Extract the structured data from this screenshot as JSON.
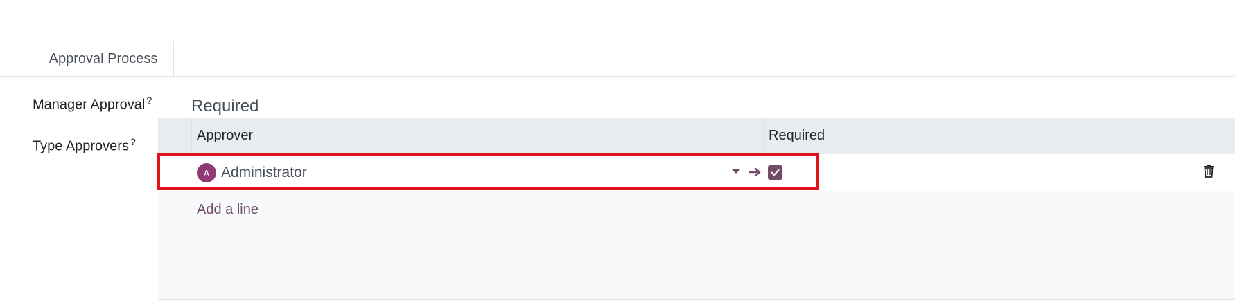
{
  "tabs": [
    {
      "label": "Approval Process"
    }
  ],
  "fields": {
    "manager_approval": {
      "label": "Manager Approval",
      "help": "?",
      "value": "Required"
    },
    "type_approvers": {
      "label": "Type Approvers",
      "help": "?"
    }
  },
  "approvers_table": {
    "columns": [
      "Approver",
      "Required"
    ],
    "rows": [
      {
        "avatar_initial": "A",
        "approver": "Administrator",
        "required": true
      }
    ],
    "add_line_label": "Add a line"
  },
  "icons": {
    "dropdown": "caret-down-icon",
    "open": "arrow-right-icon",
    "checkbox": "check-icon",
    "delete": "trash-icon"
  },
  "colors": {
    "accent": "#714b67",
    "avatar": "#8e3a75",
    "highlight": "#e0131b",
    "header_bg": "#e9ecef"
  }
}
